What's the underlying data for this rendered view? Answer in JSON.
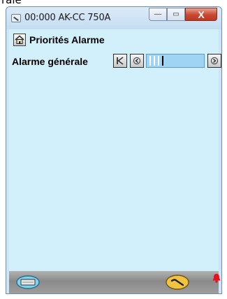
{
  "page_top_fragment": "rale",
  "window": {
    "title": "00:000 AK-CC 750A",
    "minimize_glyph": "—",
    "maximize_glyph": "▭",
    "close_glyph": "X"
  },
  "header": {
    "title": "Priorités Alarme"
  },
  "parameter": {
    "label": "Alarme générale",
    "level_index": 3,
    "level_count": 4
  },
  "colors": {
    "client_bg": "#d2f0fc",
    "slider_fill": "#9fd4f4",
    "close_red": "#c9482f",
    "alarm_red": "#e8101c"
  },
  "icons": [
    "app-icon",
    "minimize-icon",
    "maximize-icon",
    "close-icon",
    "home-icon",
    "first-icon",
    "decrement-icon",
    "increment-icon",
    "keyboard-icon",
    "settings-icon",
    "alarm-bell-icon"
  ]
}
